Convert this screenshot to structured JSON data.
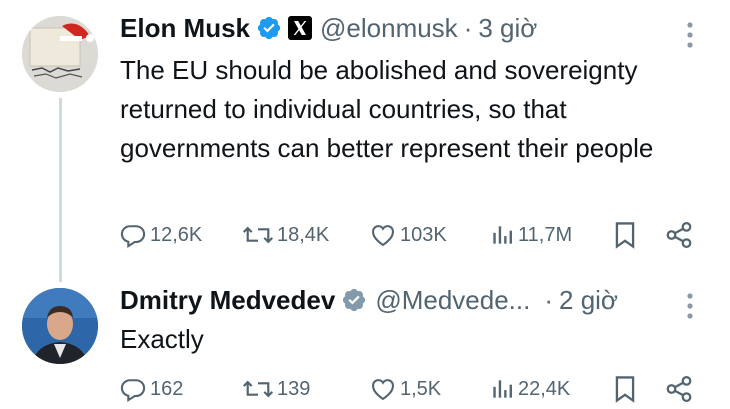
{
  "tweets": [
    {
      "author_name": "Elon Musk",
      "handle": "@elonmusk",
      "separator": "·",
      "time": "3 giờ",
      "text": "The EU should be abolished and sovereignty returned to individual countries, so that governments can better represent their people",
      "replies": "12,6K",
      "reposts": "18,4K",
      "likes": "103K",
      "views": "11,7M",
      "verified_badge_color": "#1d9bf0",
      "affiliate_icon": "x-logo-icon"
    },
    {
      "author_name": "Dmitry Medvedev",
      "handle": "@Medvede...",
      "separator": "·",
      "time": "2 giờ",
      "text": "Exactly",
      "replies": "162",
      "reposts": "139",
      "likes": "1,5K",
      "views": "22,4K",
      "verified_badge_color": "#829aab"
    }
  ],
  "colors": {
    "text": "#0f1419",
    "muted": "#536471",
    "thread_line": "#cfd9de",
    "background": "#ffffff"
  }
}
